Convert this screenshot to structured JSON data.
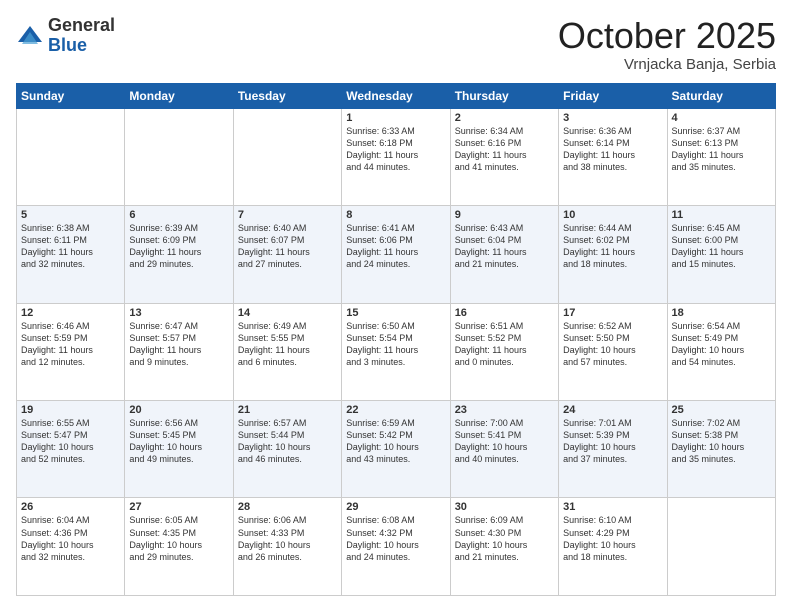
{
  "header": {
    "logo": {
      "general": "General",
      "blue": "Blue"
    },
    "title": "October 2025",
    "location": "Vrnjacka Banja, Serbia"
  },
  "weekdays": [
    "Sunday",
    "Monday",
    "Tuesday",
    "Wednesday",
    "Thursday",
    "Friday",
    "Saturday"
  ],
  "weeks": [
    [
      {
        "day": "",
        "info": ""
      },
      {
        "day": "",
        "info": ""
      },
      {
        "day": "",
        "info": ""
      },
      {
        "day": "1",
        "info": "Sunrise: 6:33 AM\nSunset: 6:18 PM\nDaylight: 11 hours\nand 44 minutes."
      },
      {
        "day": "2",
        "info": "Sunrise: 6:34 AM\nSunset: 6:16 PM\nDaylight: 11 hours\nand 41 minutes."
      },
      {
        "day": "3",
        "info": "Sunrise: 6:36 AM\nSunset: 6:14 PM\nDaylight: 11 hours\nand 38 minutes."
      },
      {
        "day": "4",
        "info": "Sunrise: 6:37 AM\nSunset: 6:13 PM\nDaylight: 11 hours\nand 35 minutes."
      }
    ],
    [
      {
        "day": "5",
        "info": "Sunrise: 6:38 AM\nSunset: 6:11 PM\nDaylight: 11 hours\nand 32 minutes."
      },
      {
        "day": "6",
        "info": "Sunrise: 6:39 AM\nSunset: 6:09 PM\nDaylight: 11 hours\nand 29 minutes."
      },
      {
        "day": "7",
        "info": "Sunrise: 6:40 AM\nSunset: 6:07 PM\nDaylight: 11 hours\nand 27 minutes."
      },
      {
        "day": "8",
        "info": "Sunrise: 6:41 AM\nSunset: 6:06 PM\nDaylight: 11 hours\nand 24 minutes."
      },
      {
        "day": "9",
        "info": "Sunrise: 6:43 AM\nSunset: 6:04 PM\nDaylight: 11 hours\nand 21 minutes."
      },
      {
        "day": "10",
        "info": "Sunrise: 6:44 AM\nSunset: 6:02 PM\nDaylight: 11 hours\nand 18 minutes."
      },
      {
        "day": "11",
        "info": "Sunrise: 6:45 AM\nSunset: 6:00 PM\nDaylight: 11 hours\nand 15 minutes."
      }
    ],
    [
      {
        "day": "12",
        "info": "Sunrise: 6:46 AM\nSunset: 5:59 PM\nDaylight: 11 hours\nand 12 minutes."
      },
      {
        "day": "13",
        "info": "Sunrise: 6:47 AM\nSunset: 5:57 PM\nDaylight: 11 hours\nand 9 minutes."
      },
      {
        "day": "14",
        "info": "Sunrise: 6:49 AM\nSunset: 5:55 PM\nDaylight: 11 hours\nand 6 minutes."
      },
      {
        "day": "15",
        "info": "Sunrise: 6:50 AM\nSunset: 5:54 PM\nDaylight: 11 hours\nand 3 minutes."
      },
      {
        "day": "16",
        "info": "Sunrise: 6:51 AM\nSunset: 5:52 PM\nDaylight: 11 hours\nand 0 minutes."
      },
      {
        "day": "17",
        "info": "Sunrise: 6:52 AM\nSunset: 5:50 PM\nDaylight: 10 hours\nand 57 minutes."
      },
      {
        "day": "18",
        "info": "Sunrise: 6:54 AM\nSunset: 5:49 PM\nDaylight: 10 hours\nand 54 minutes."
      }
    ],
    [
      {
        "day": "19",
        "info": "Sunrise: 6:55 AM\nSunset: 5:47 PM\nDaylight: 10 hours\nand 52 minutes."
      },
      {
        "day": "20",
        "info": "Sunrise: 6:56 AM\nSunset: 5:45 PM\nDaylight: 10 hours\nand 49 minutes."
      },
      {
        "day": "21",
        "info": "Sunrise: 6:57 AM\nSunset: 5:44 PM\nDaylight: 10 hours\nand 46 minutes."
      },
      {
        "day": "22",
        "info": "Sunrise: 6:59 AM\nSunset: 5:42 PM\nDaylight: 10 hours\nand 43 minutes."
      },
      {
        "day": "23",
        "info": "Sunrise: 7:00 AM\nSunset: 5:41 PM\nDaylight: 10 hours\nand 40 minutes."
      },
      {
        "day": "24",
        "info": "Sunrise: 7:01 AM\nSunset: 5:39 PM\nDaylight: 10 hours\nand 37 minutes."
      },
      {
        "day": "25",
        "info": "Sunrise: 7:02 AM\nSunset: 5:38 PM\nDaylight: 10 hours\nand 35 minutes."
      }
    ],
    [
      {
        "day": "26",
        "info": "Sunrise: 6:04 AM\nSunset: 4:36 PM\nDaylight: 10 hours\nand 32 minutes."
      },
      {
        "day": "27",
        "info": "Sunrise: 6:05 AM\nSunset: 4:35 PM\nDaylight: 10 hours\nand 29 minutes."
      },
      {
        "day": "28",
        "info": "Sunrise: 6:06 AM\nSunset: 4:33 PM\nDaylight: 10 hours\nand 26 minutes."
      },
      {
        "day": "29",
        "info": "Sunrise: 6:08 AM\nSunset: 4:32 PM\nDaylight: 10 hours\nand 24 minutes."
      },
      {
        "day": "30",
        "info": "Sunrise: 6:09 AM\nSunset: 4:30 PM\nDaylight: 10 hours\nand 21 minutes."
      },
      {
        "day": "31",
        "info": "Sunrise: 6:10 AM\nSunset: 4:29 PM\nDaylight: 10 hours\nand 18 minutes."
      },
      {
        "day": "",
        "info": ""
      }
    ]
  ]
}
